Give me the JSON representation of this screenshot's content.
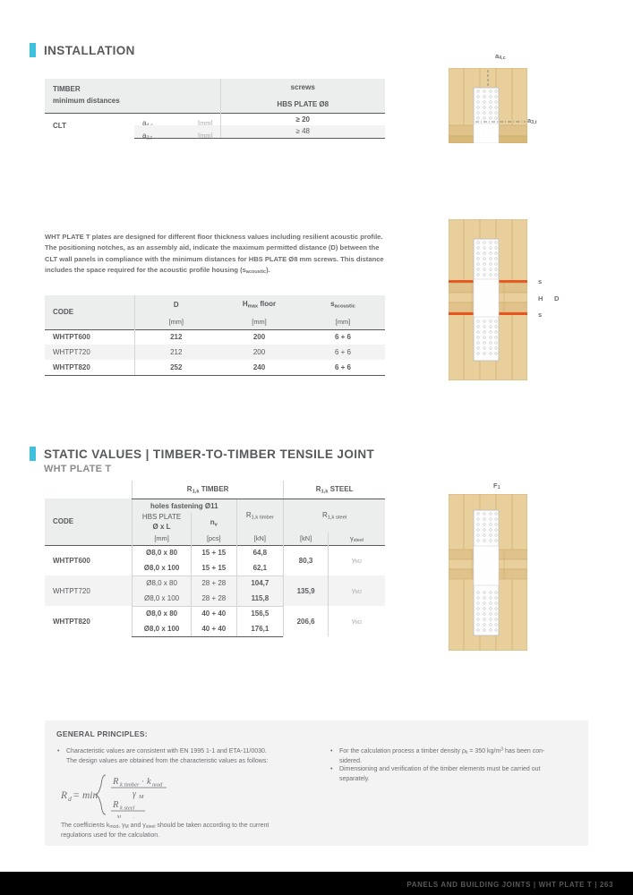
{
  "sections": {
    "installation": {
      "title": "INSTALLATION"
    },
    "static": {
      "title": "STATIC VALUES | TIMBER-TO-TIMBER TENSILE JOINT",
      "subtitle": "WHT PLATE T"
    }
  },
  "table_installation": {
    "header": {
      "left_line1": "TIMBER",
      "left_line2": "minimum distances",
      "right_line1": "screws",
      "right_line2": "HBS PLATE Ø8"
    },
    "material": "CLT",
    "rows": [
      {
        "symbol": "a",
        "sub": "4,c",
        "unit": "[mm]",
        "value": "≥ 20"
      },
      {
        "symbol": "a",
        "sub": "3,t",
        "unit": "[mm]",
        "value": "≥ 48"
      }
    ]
  },
  "paragraph": "WHT PLATE T plates are designed for different floor thickness values including resilient acoustic profile. The positioning notches, as an assembly aid, indicate the maximum permitted distance (D) between the CLT wall panels in compliance with the minimum distances for HBS PLATE Ø8 mm screws. This distance includes the space required for the acoustic profile housing (sacoustic).",
  "table_geometry": {
    "headers": [
      {
        "label": "CODE",
        "unit": ""
      },
      {
        "label": "D",
        "unit": "[mm]"
      },
      {
        "label": "Hmax floor",
        "unit": "[mm]"
      },
      {
        "label": "sacoustic",
        "unit": "[mm]"
      }
    ],
    "rows": [
      {
        "code": "WHTPT600",
        "d": "212",
        "hmax": "200",
        "sac": "6 + 6"
      },
      {
        "code": "WHTPT720",
        "d": "212",
        "hmax": "200",
        "sac": "6 + 6"
      },
      {
        "code": "WHTPT820",
        "d": "252",
        "hmax": "240",
        "sac": "6 + 6"
      }
    ]
  },
  "table_static": {
    "group_timber": "R1,k TIMBER",
    "group_steel": "R1,k STEEL",
    "headers": {
      "code": "CODE",
      "holes": "holes fastening Ø11",
      "hbs_line1": "HBS PLATE",
      "hbs_line2": "Ø x L",
      "hbs_unit": "[mm]",
      "nv": "nv",
      "nv_unit": "[pcs]",
      "r1k_timber": "R1,k timber",
      "r1k_timber_unit": "[kN]",
      "r1k_steel": "R1,k steel",
      "r1k_steel_unit": "[kN]",
      "gamma_steel": "γsteel"
    },
    "rows": [
      {
        "code": "WHTPT600",
        "lines": [
          {
            "hbs": "Ø8,0 x 80",
            "nv": "15 + 15",
            "rtimber": "64,8"
          },
          {
            "hbs": "Ø8,0 x 100",
            "nv": "15 + 15",
            "rtimber": "62,1"
          }
        ],
        "rsteel": "80,3",
        "gamma": "γM2"
      },
      {
        "code": "WHTPT720",
        "lines": [
          {
            "hbs": "Ø8,0 x 80",
            "nv": "28 + 28",
            "rtimber": "104,7"
          },
          {
            "hbs": "Ø8,0 x 100",
            "nv": "28 + 28",
            "rtimber": "115,8"
          }
        ],
        "rsteel": "135,9",
        "gamma": "γM2"
      },
      {
        "code": "WHTPT820",
        "lines": [
          {
            "hbs": "Ø8,0 x 80",
            "nv": "40 + 40",
            "rtimber": "156,5"
          },
          {
            "hbs": "Ø8,0 x 100",
            "nv": "40 + 40",
            "rtimber": "176,1"
          }
        ],
        "rsteel": "206,6",
        "gamma": "γM2"
      }
    ]
  },
  "figures": {
    "fig1": {
      "label_top": "a4,c",
      "label_right": "a3,t"
    },
    "fig2": {
      "label_s_top": "s",
      "label_h": "H",
      "label_d": "D",
      "label_s_bottom": "s"
    },
    "fig3": {
      "label_top": "F1"
    }
  },
  "general_principles": {
    "title": "GENERAL PRINCIPLES:",
    "left": {
      "bullet1_line1": "Characteristic values are consistent with EN 1995 1-1 and ETA-11/0030.",
      "bullet1_line2": "The design values are obtained from the characteristic values as follows:",
      "formula_lhs": "Rd = min",
      "formula_num1": "Rk timber · kmod",
      "formula_den1": "γM",
      "formula_num2": "Rk steel",
      "formula_den2": "γsteel",
      "note_line1": "The coefficients kmod, γM and γsteel should be taken according to the current",
      "note_line2": "regulations used for the calculation."
    },
    "right": {
      "bullet1_line1": "For the calculation process a timber density ρk = 350 kg/m3 has been con-",
      "bullet1_line2": "sidered.",
      "bullet2_line1": "Dimensioning and verification of the timber elements must be carried out",
      "bullet2_line2": "separately."
    }
  },
  "footer": {
    "text": "PANELS AND BUILDING JOINTS  |  WHT PLATE T  |  263"
  },
  "colors": {
    "accent": "#3ec1e0",
    "text": "#58595b",
    "muted": "#a7a9ac",
    "row_alt": "#f3f3f4",
    "header_fill": "#eceded",
    "timber": "#e8cf9c",
    "timber_dark": "#d8b878",
    "acoustic": "#e8531f"
  }
}
